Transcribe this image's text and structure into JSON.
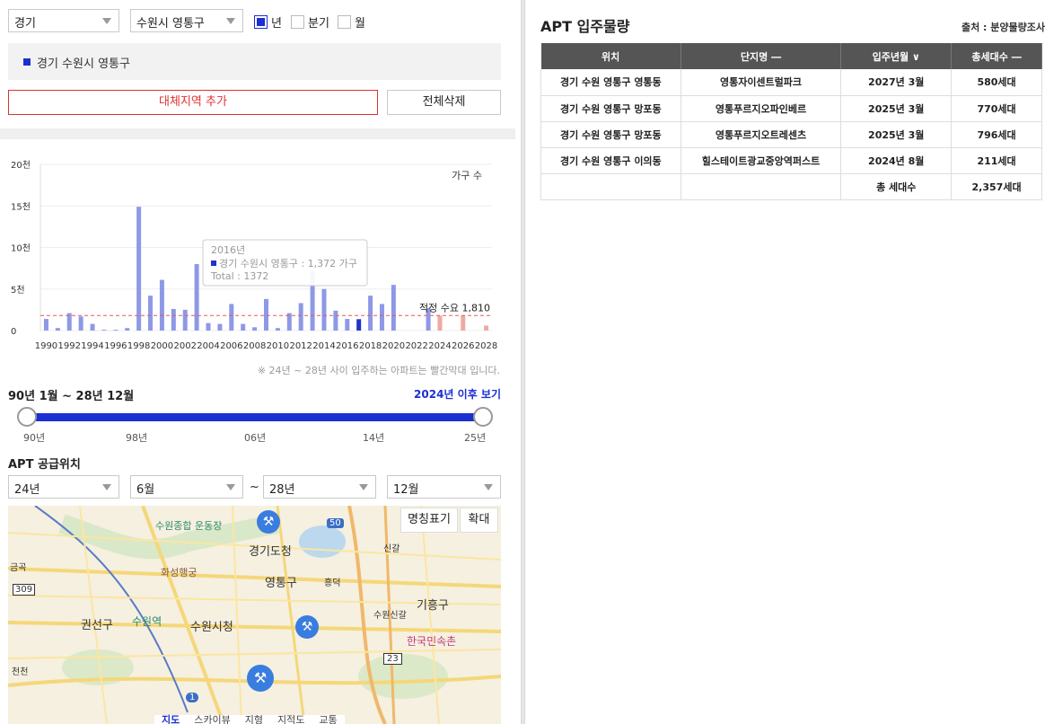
{
  "filters": {
    "province": "경기",
    "city": "수원시 영통구",
    "period_options": [
      {
        "label": "년",
        "checked": true
      },
      {
        "label": "분기",
        "checked": false
      },
      {
        "label": "월",
        "checked": false
      }
    ]
  },
  "region_list": {
    "item": "경기 수원시 영통구"
  },
  "buttons": {
    "add": "대체지역 추가",
    "clear": "전체삭제"
  },
  "chart_data": {
    "type": "bar",
    "unit_label": "가구 수",
    "y_ticks": [
      "0",
      "5천",
      "10천",
      "15천",
      "20천"
    ],
    "ylim": [
      0,
      20000
    ],
    "x_tick_labels": [
      "1990",
      "1992",
      "1994",
      "1996",
      "1998",
      "2000",
      "2002",
      "2004",
      "2006",
      "2008",
      "2010",
      "2012",
      "2014",
      "2016",
      "2018",
      "2020",
      "2022",
      "2024",
      "2026",
      "2028"
    ],
    "categories": [
      1990,
      1991,
      1992,
      1993,
      1994,
      1995,
      1996,
      1997,
      1998,
      1999,
      2000,
      2001,
      2002,
      2003,
      2004,
      2005,
      2006,
      2007,
      2008,
      2009,
      2010,
      2011,
      2012,
      2013,
      2014,
      2015,
      2016,
      2017,
      2018,
      2019,
      2020,
      2021,
      2022,
      2023,
      2024,
      2025,
      2026,
      2027,
      2028
    ],
    "values": [
      1400,
      300,
      2100,
      1700,
      800,
      100,
      100,
      300,
      14900,
      4200,
      6100,
      2600,
      2500,
      8000,
      900,
      800,
      3200,
      800,
      400,
      3800,
      300,
      2100,
      3300,
      7200,
      5000,
      2400,
      1400,
      1372,
      4200,
      3200,
      5500,
      0,
      0,
      2700,
      1800,
      0,
      1800,
      0,
      600
    ],
    "highlight_year": 2017,
    "future_from": 2024,
    "target_line": {
      "value": 1810,
      "label": "적정 수요 1,810"
    },
    "tooltip": {
      "year": "2016년",
      "series": "경기 수원시 영통구 : 1,372 가구",
      "total": "Total : 1372"
    },
    "colors": {
      "bar": "#8d99e6",
      "highlight": "#2233c9",
      "future": "#f0a9a0",
      "target": "#e05c5c"
    }
  },
  "chart_note": "※ 24년 ~ 28년 사이 입주하는 아파트는 빨간막대 입니다.",
  "period": {
    "title": "90년 1월 ~ 28년 12월",
    "link": "2024년 이후 보기",
    "range_start": "90년",
    "range_end": "25년",
    "tick_labels": [
      "90년",
      "98년",
      "06년",
      "14년",
      "25년"
    ]
  },
  "supply": {
    "title": "APT 공급위치",
    "from_year": "24년",
    "from_month": "6월",
    "separator": "~",
    "to_year": "28년",
    "to_month": "12월"
  },
  "map": {
    "buttons": {
      "label_toggle": "명칭표기",
      "zoom": "확대"
    },
    "labels": {
      "gyeonggi_office": "경기도청",
      "yeongtong": "영통구",
      "suwon_city_hall": "수원시청",
      "gwonseon": "권선구",
      "suwon_station": "수원역",
      "giheung": "기흥구",
      "folk_village": "한국민속촌",
      "sports": "수원종합\n운동장",
      "hwaseong": "화성행궁",
      "heungdeok": "흥덕",
      "suwon_sinn": "수원신갈",
      "singal": "신갈",
      "geumgok": "금곡",
      "cheoncheon": "천천",
      "route_50": "50",
      "route_309": "309",
      "route_23": "23",
      "route_1": "1"
    },
    "tabs": [
      "지도",
      "스카이뷰",
      "지형",
      "지적도",
      "교통"
    ]
  },
  "right": {
    "title": "APT 입주물량",
    "source": "출처 : 분양물량조사",
    "table": {
      "headers": [
        "위치",
        "단지명 ―",
        "입주년월 ∨",
        "총세대수 ―"
      ],
      "rows": [
        [
          "경기 수원 영통구 영통동",
          "영통자이센트럴파크",
          "2027년 3월",
          "580세대"
        ],
        [
          "경기 수원 영통구 망포동",
          "영통푸르지오파인베르",
          "2025년 3월",
          "770세대"
        ],
        [
          "경기 수원 영통구 망포동",
          "영통푸르지오트레센츠",
          "2025년 3월",
          "796세대"
        ],
        [
          "경기 수원 영통구 이의동",
          "힐스테이트광교중앙역퍼스트",
          "2024년 8월",
          "211세대"
        ]
      ],
      "total_label": "총 세대수",
      "total_value": "2,357세대"
    }
  }
}
